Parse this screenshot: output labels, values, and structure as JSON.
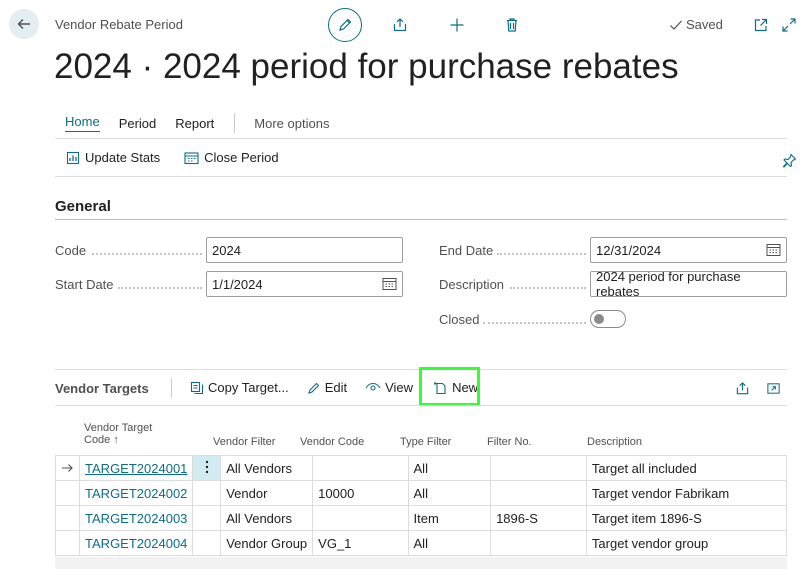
{
  "header": {
    "breadcrumb": "Vendor Rebate Period",
    "saved_label": "Saved",
    "title": "2024 · 2024 period for purchase rebates"
  },
  "menu": {
    "home": "Home",
    "period": "Period",
    "report": "Report",
    "more": "More options"
  },
  "actions": {
    "update_stats": "Update Stats",
    "close_period": "Close Period"
  },
  "general": {
    "title": "General",
    "code_label": "Code",
    "code_value": "2024",
    "start_date_label": "Start Date",
    "start_date_value": "1/1/2024",
    "end_date_label": "End Date",
    "end_date_value": "12/31/2024",
    "description_label": "Description",
    "description_value": "2024 period for purchase rebates",
    "closed_label": "Closed",
    "closed_value": false
  },
  "vendor_targets": {
    "title": "Vendor Targets",
    "copy_target": "Copy Target...",
    "edit": "Edit",
    "view": "View",
    "new": "New",
    "columns": {
      "code_line1": "Vendor Target",
      "code_line2": "Code",
      "code_sort": "↑",
      "vendor_filter": "Vendor Filter",
      "vendor_code": "Vendor Code",
      "type_filter": "Type Filter",
      "filter_no": "Filter No.",
      "description": "Description"
    },
    "rows": [
      {
        "code": "TARGET2024001",
        "vendor_filter": "All Vendors",
        "vendor_code": "",
        "type_filter": "All",
        "filter_no": "",
        "description": "Target all included"
      },
      {
        "code": "TARGET2024002",
        "vendor_filter": "Vendor",
        "vendor_code": "10000",
        "type_filter": "All",
        "filter_no": "",
        "description": "Target vendor Fabrikam"
      },
      {
        "code": "TARGET2024003",
        "vendor_filter": "All Vendors",
        "vendor_code": "",
        "type_filter": "Item",
        "filter_no": "1896-S",
        "description": "Target item 1896-S"
      },
      {
        "code": "TARGET2024004",
        "vendor_filter": "Vendor Group",
        "vendor_code": "VG_1",
        "type_filter": "All",
        "filter_no": "",
        "description": "Target vendor group"
      }
    ]
  },
  "colors": {
    "accent": "#0b6e85",
    "highlight": "#33ff33",
    "selected_cell": "#d0ebf2"
  },
  "icons": [
    "back-arrow-icon",
    "pencil-icon",
    "share-icon",
    "plus-icon",
    "trash-icon",
    "check-icon",
    "open-new-window-icon",
    "expand-icon",
    "chart-doc-icon",
    "calendar-close-icon",
    "pin-icon",
    "calendar-icon",
    "copy-icon",
    "eye-icon",
    "new-doc-icon",
    "row-arrow-icon",
    "ellipsis-vertical-icon"
  ]
}
